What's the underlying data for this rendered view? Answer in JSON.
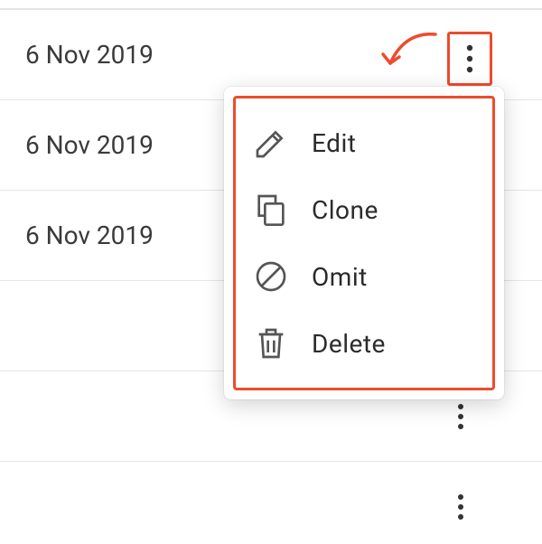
{
  "rows": [
    {
      "date": "6 Nov 2019"
    },
    {
      "date": "6 Nov 2019"
    },
    {
      "date": "6 Nov 2019"
    },
    {
      "date": ""
    },
    {
      "date": ""
    },
    {
      "date": ""
    }
  ],
  "menu": {
    "items": [
      {
        "label": "Edit",
        "icon": "pencil-icon"
      },
      {
        "label": "Clone",
        "icon": "copy-icon"
      },
      {
        "label": "Omit",
        "icon": "prohibit-icon"
      },
      {
        "label": "Delete",
        "icon": "trash-icon"
      }
    ]
  },
  "colors": {
    "highlight": "#ee4b2b"
  }
}
